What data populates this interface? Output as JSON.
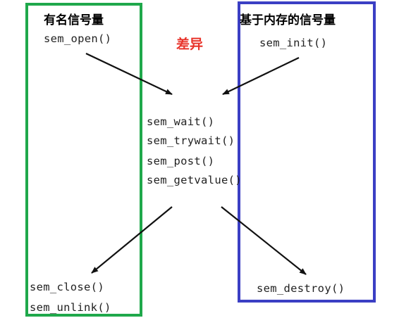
{
  "left_group": {
    "title": "有名信号量",
    "color": "#1fa84b"
  },
  "right_group": {
    "title": "基于内存的信号量",
    "color": "#3b3fc4"
  },
  "difference_label": {
    "text": "差异",
    "color": "#e8332a"
  },
  "functions": {
    "open": "sem_open()",
    "init": "sem_init()",
    "wait": "sem_wait()",
    "trywait": "sem_trywait()",
    "post": "sem_post()",
    "getvalue": "sem_getvalue()",
    "close": "sem_close()",
    "unlink": "sem_unlink()",
    "destroy": "sem_destroy()"
  }
}
